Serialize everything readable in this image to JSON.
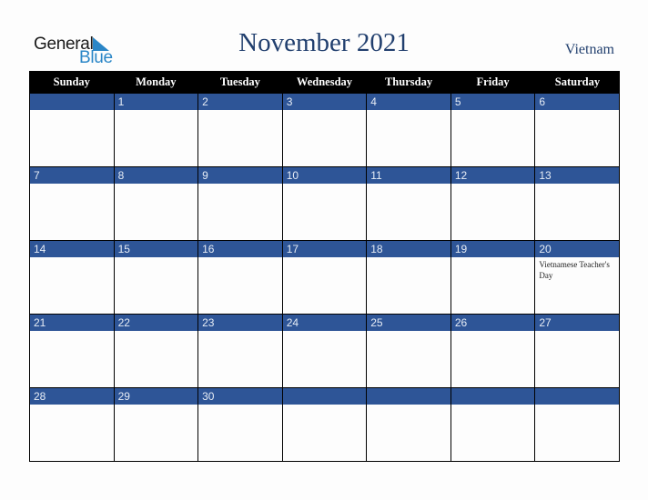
{
  "logo": {
    "word1": "General",
    "word2": "Blue"
  },
  "header": {
    "title": "November 2021",
    "country": "Vietnam"
  },
  "colors": {
    "title": "#213f6e",
    "date_bar": "#2e5597",
    "header_bg": "#000000",
    "logo_blue": "#2a86c7"
  },
  "weekdays": [
    "Sunday",
    "Monday",
    "Tuesday",
    "Wednesday",
    "Thursday",
    "Friday",
    "Saturday"
  ],
  "weeks": [
    [
      {
        "d": "",
        "e": ""
      },
      {
        "d": "1",
        "e": ""
      },
      {
        "d": "2",
        "e": ""
      },
      {
        "d": "3",
        "e": ""
      },
      {
        "d": "4",
        "e": ""
      },
      {
        "d": "5",
        "e": ""
      },
      {
        "d": "6",
        "e": ""
      }
    ],
    [
      {
        "d": "7",
        "e": ""
      },
      {
        "d": "8",
        "e": ""
      },
      {
        "d": "9",
        "e": ""
      },
      {
        "d": "10",
        "e": ""
      },
      {
        "d": "11",
        "e": ""
      },
      {
        "d": "12",
        "e": ""
      },
      {
        "d": "13",
        "e": ""
      }
    ],
    [
      {
        "d": "14",
        "e": ""
      },
      {
        "d": "15",
        "e": ""
      },
      {
        "d": "16",
        "e": ""
      },
      {
        "d": "17",
        "e": ""
      },
      {
        "d": "18",
        "e": ""
      },
      {
        "d": "19",
        "e": ""
      },
      {
        "d": "20",
        "e": "Vietnamese Teacher's Day"
      }
    ],
    [
      {
        "d": "21",
        "e": ""
      },
      {
        "d": "22",
        "e": ""
      },
      {
        "d": "23",
        "e": ""
      },
      {
        "d": "24",
        "e": ""
      },
      {
        "d": "25",
        "e": ""
      },
      {
        "d": "26",
        "e": ""
      },
      {
        "d": "27",
        "e": ""
      }
    ],
    [
      {
        "d": "28",
        "e": ""
      },
      {
        "d": "29",
        "e": ""
      },
      {
        "d": "30",
        "e": ""
      },
      {
        "d": "",
        "e": ""
      },
      {
        "d": "",
        "e": ""
      },
      {
        "d": "",
        "e": ""
      },
      {
        "d": "",
        "e": ""
      }
    ]
  ]
}
